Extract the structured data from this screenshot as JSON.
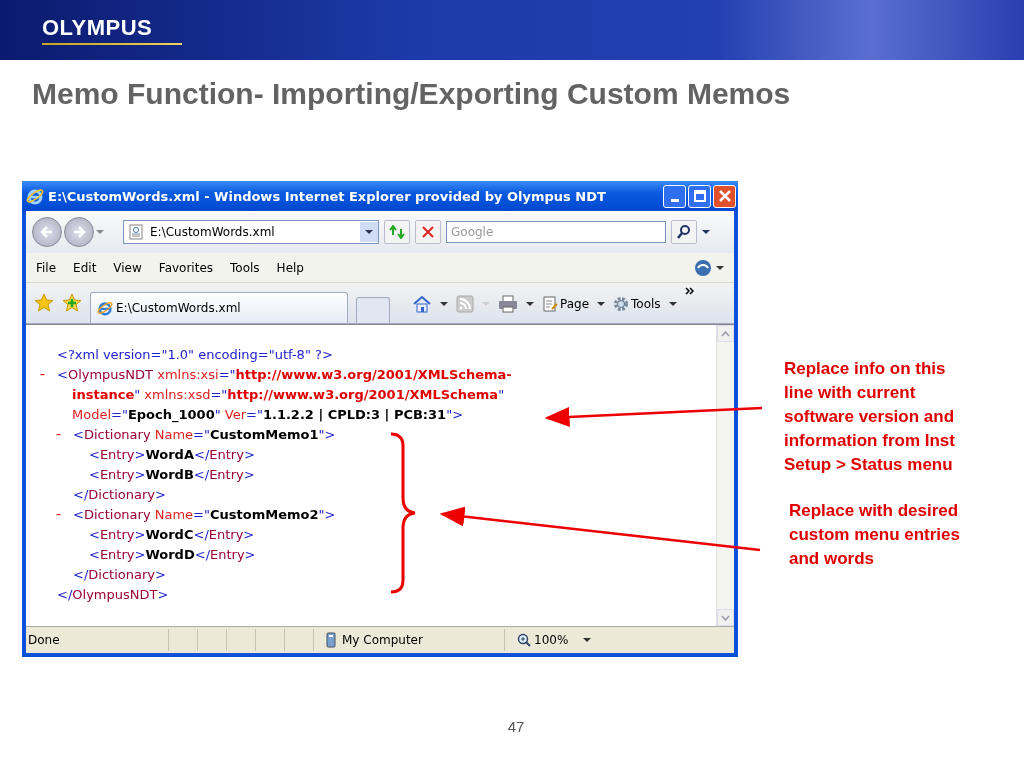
{
  "header": {
    "logo": "OLYMPUS"
  },
  "title": "Memo Function- Importing/Exporting Custom Memos",
  "browser": {
    "title": "E:\\CustomWords.xml - Windows Internet Explorer provided by Olympus NDT",
    "address": "E:\\CustomWords.xml",
    "search_placeholder": "Google",
    "menu": [
      "File",
      "Edit",
      "View",
      "Favorites",
      "Tools",
      "Help"
    ],
    "tabs": [
      {
        "label": "E:\\CustomWords.xml",
        "selected": true
      }
    ],
    "commands": [
      {
        "kind": "page",
        "label": "Page"
      },
      {
        "kind": "tools",
        "label": "Tools"
      }
    ],
    "xml": {
      "declaration": [
        {
          "kind": "mark",
          "text": "<?xml version=\"1.0\" encoding=\"utf-8\" ?>"
        }
      ],
      "root": {
        "toggle": "-",
        "open": [
          [
            {
              "kind": "mark",
              "text": "<"
            },
            {
              "kind": "tag",
              "text": "OlympusNDT"
            },
            {
              "kind": "attr",
              "text": " xmlns:xsi"
            },
            {
              "kind": "mark",
              "text": "=\""
            },
            {
              "kind": "val",
              "text": "http://www.w3.org/2001/XMLSchema-"
            }
          ],
          [
            {
              "kind": "val",
              "text": "instance"
            },
            {
              "kind": "mark",
              "text": "\""
            },
            {
              "kind": "attr",
              "text": " xmlns:xsd"
            },
            {
              "kind": "mark",
              "text": "=\""
            },
            {
              "kind": "val",
              "text": "http://www.w3.org/2001/XMLSchema"
            },
            {
              "kind": "mark",
              "text": "\""
            }
          ],
          [
            {
              "kind": "attr",
              "text": "Model"
            },
            {
              "kind": "mark",
              "text": "=\""
            },
            {
              "kind": "content",
              "text": "Epoch_1000"
            },
            {
              "kind": "mark",
              "text": "\""
            },
            {
              "kind": "attr",
              "text": " Ver"
            },
            {
              "kind": "mark",
              "text": "=\""
            },
            {
              "kind": "content",
              "text": "1.1.2.2 | CPLD:3 | PCB:31"
            },
            {
              "kind": "mark",
              "text": "\">"
            }
          ]
        ],
        "children": [
          {
            "toggle": "-",
            "open": [
              [
                {
                  "kind": "mark",
                  "text": "<"
                },
                {
                  "kind": "tag",
                  "text": "Dictionary"
                },
                {
                  "kind": "attr",
                  "text": " Name"
                },
                {
                  "kind": "mark",
                  "text": "=\""
                },
                {
                  "kind": "content",
                  "text": "CustomMemo1"
                },
                {
                  "kind": "mark",
                  "text": "\">"
                }
              ]
            ],
            "children": [
              {
                "open": [
                  [
                    {
                      "kind": "mark",
                      "text": "<"
                    },
                    {
                      "kind": "tag",
                      "text": "Entry"
                    },
                    {
                      "kind": "mark",
                      "text": ">"
                    },
                    {
                      "kind": "content",
                      "text": "WordA"
                    },
                    {
                      "kind": "mark",
                      "text": "</"
                    },
                    {
                      "kind": "tag",
                      "text": "Entry"
                    },
                    {
                      "kind": "mark",
                      "text": ">"
                    }
                  ]
                ]
              },
              {
                "open": [
                  [
                    {
                      "kind": "mark",
                      "text": "<"
                    },
                    {
                      "kind": "tag",
                      "text": "Entry"
                    },
                    {
                      "kind": "mark",
                      "text": ">"
                    },
                    {
                      "kind": "content",
                      "text": "WordB"
                    },
                    {
                      "kind": "mark",
                      "text": "</"
                    },
                    {
                      "kind": "tag",
                      "text": "Entry"
                    },
                    {
                      "kind": "mark",
                      "text": ">"
                    }
                  ]
                ]
              }
            ],
            "close": [
              {
                "kind": "mark",
                "text": "</"
              },
              {
                "kind": "tag",
                "text": "Dictionary"
              },
              {
                "kind": "mark",
                "text": ">"
              }
            ]
          },
          {
            "toggle": "-",
            "open": [
              [
                {
                  "kind": "mark",
                  "text": "<"
                },
                {
                  "kind": "tag",
                  "text": "Dictionary"
                },
                {
                  "kind": "attr",
                  "text": " Name"
                },
                {
                  "kind": "mark",
                  "text": "=\""
                },
                {
                  "kind": "content",
                  "text": "CustomMemo2"
                },
                {
                  "kind": "mark",
                  "text": "\">"
                }
              ]
            ],
            "children": [
              {
                "open": [
                  [
                    {
                      "kind": "mark",
                      "text": "<"
                    },
                    {
                      "kind": "tag",
                      "text": "Entry"
                    },
                    {
                      "kind": "mark",
                      "text": ">"
                    },
                    {
                      "kind": "content",
                      "text": "WordC"
                    },
                    {
                      "kind": "mark",
                      "text": "</"
                    },
                    {
                      "kind": "tag",
                      "text": "Entry"
                    },
                    {
                      "kind": "mark",
                      "text": ">"
                    }
                  ]
                ]
              },
              {
                "open": [
                  [
                    {
                      "kind": "mark",
                      "text": "<"
                    },
                    {
                      "kind": "tag",
                      "text": "Entry"
                    },
                    {
                      "kind": "mark",
                      "text": ">"
                    },
                    {
                      "kind": "content",
                      "text": "WordD"
                    },
                    {
                      "kind": "mark",
                      "text": "</"
                    },
                    {
                      "kind": "tag",
                      "text": "Entry"
                    },
                    {
                      "kind": "mark",
                      "text": ">"
                    }
                  ]
                ]
              }
            ],
            "close": [
              {
                "kind": "mark",
                "text": "</"
              },
              {
                "kind": "tag",
                "text": "Dictionary"
              },
              {
                "kind": "mark",
                "text": ">"
              }
            ]
          }
        ],
        "close": [
          {
            "kind": "mark",
            "text": "</"
          },
          {
            "kind": "tag",
            "text": "OlympusNDT"
          },
          {
            "kind": "mark",
            "text": ">"
          }
        ]
      }
    },
    "status": {
      "text": "Done",
      "zone": "My Computer",
      "zoom": "100%"
    }
  },
  "annotations": [
    {
      "text": "Replace info on this line with current software version and information from Inst Setup > Status menu"
    },
    {
      "text": "Replace with desired custom menu entries and words"
    }
  ],
  "page_number": "47"
}
